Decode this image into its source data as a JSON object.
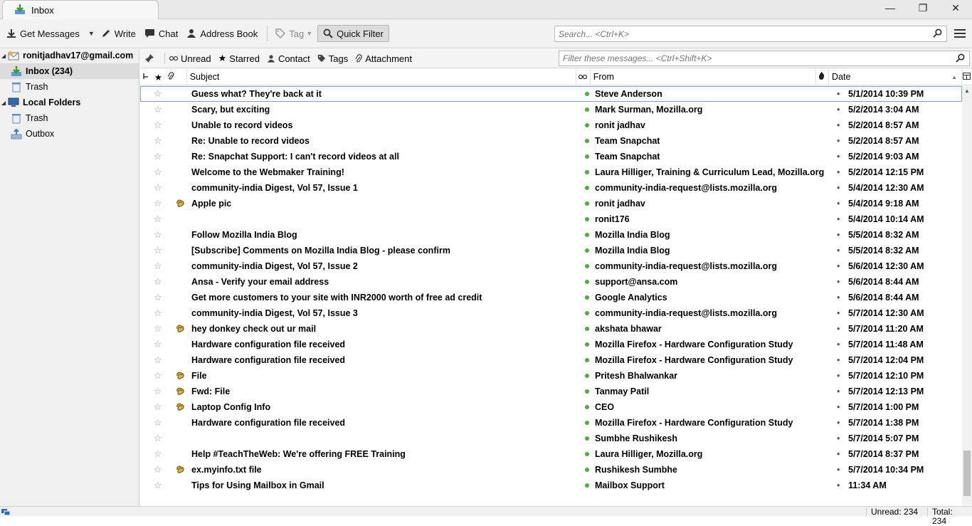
{
  "tab": {
    "title": "Inbox",
    "icon": "inbox-tab-icon"
  },
  "window_controls": {
    "minimize": "—",
    "restore": "❐",
    "close": "✕"
  },
  "toolbar": {
    "get_messages": "Get Messages",
    "write": "Write",
    "chat": "Chat",
    "address_book": "Address Book",
    "tag": "Tag",
    "quick_filter": "Quick Filter",
    "search_placeholder": "Search... <Ctrl+K>"
  },
  "folders": {
    "account": "ronitjadhav17@gmail.com",
    "inbox": "Inbox (234)",
    "trash1": "Trash",
    "local_folders": "Local Folders",
    "trash2": "Trash",
    "outbox": "Outbox"
  },
  "quickfilter": {
    "unread": "Unread",
    "starred": "Starred",
    "contact": "Contact",
    "tags": "Tags",
    "attachment": "Attachment",
    "filter_placeholder": "Filter these messages... <Ctrl+Shift+K>"
  },
  "columns": {
    "subject": "Subject",
    "from": "From",
    "date": "Date"
  },
  "messages": [
    {
      "subject": "Guess what? They're back at it",
      "from": "Steve Anderson",
      "date": "5/1/2014 10:39 PM",
      "attachment": false
    },
    {
      "subject": "Scary, but exciting",
      "from": "Mark Surman, Mozilla.org",
      "date": "5/2/2014 3:04 AM",
      "attachment": false
    },
    {
      "subject": "Unable to record videos",
      "from": "ronit jadhav",
      "date": "5/2/2014 8:57 AM",
      "attachment": false
    },
    {
      "subject": "Re: Unable to record videos",
      "from": "Team Snapchat",
      "date": "5/2/2014 8:57 AM",
      "attachment": false
    },
    {
      "subject": "Re: Snapchat Support: I can't record videos at all",
      "from": "Team Snapchat",
      "date": "5/2/2014 9:03 AM",
      "attachment": false
    },
    {
      "subject": "Welcome to the Webmaker Training!",
      "from": "Laura Hilliger, Training & Curriculum Lead, Mozilla.org",
      "date": "5/2/2014 12:15 PM",
      "attachment": false
    },
    {
      "subject": "community-india Digest, Vol 57, Issue 1",
      "from": "community-india-request@lists.mozilla.org",
      "date": "5/4/2014 12:30 AM",
      "attachment": false
    },
    {
      "subject": "Apple pic",
      "from": "ronit jadhav",
      "date": "5/4/2014 9:18 AM",
      "attachment": true
    },
    {
      "subject": "",
      "from": "ronit176",
      "date": "5/4/2014 10:14 AM",
      "attachment": false
    },
    {
      "subject": "Follow Mozilla India Blog",
      "from": "Mozilla India Blog",
      "date": "5/5/2014 8:32 AM",
      "attachment": false
    },
    {
      "subject": "[Subscribe] Comments on Mozilla India Blog - please confirm",
      "from": "Mozilla India Blog",
      "date": "5/5/2014 8:32 AM",
      "attachment": false
    },
    {
      "subject": "community-india Digest, Vol 57, Issue 2",
      "from": "community-india-request@lists.mozilla.org",
      "date": "5/6/2014 12:30 AM",
      "attachment": false
    },
    {
      "subject": "Ansa - Verify your email address",
      "from": "support@ansa.com",
      "date": "5/6/2014 8:44 AM",
      "attachment": false
    },
    {
      "subject": "Get more customers to your site with INR2000 worth of free ad credit",
      "from": "Google Analytics",
      "date": "5/6/2014 8:44 AM",
      "attachment": false
    },
    {
      "subject": "community-india Digest, Vol 57, Issue 3",
      "from": "community-india-request@lists.mozilla.org",
      "date": "5/7/2014 12:30 AM",
      "attachment": false
    },
    {
      "subject": "hey donkey check out ur mail",
      "from": "akshata bhawar",
      "date": "5/7/2014 11:20 AM",
      "attachment": true
    },
    {
      "subject": "Hardware configuration file received",
      "from": "Mozilla Firefox - Hardware Configuration Study",
      "date": "5/7/2014 11:48 AM",
      "attachment": false
    },
    {
      "subject": "Hardware configuration file received",
      "from": "Mozilla Firefox - Hardware Configuration Study",
      "date": "5/7/2014 12:04 PM",
      "attachment": false
    },
    {
      "subject": "File",
      "from": "Pritesh Bhalwankar",
      "date": "5/7/2014 12:10 PM",
      "attachment": true
    },
    {
      "subject": "Fwd: File",
      "from": "Tanmay Patil",
      "date": "5/7/2014 12:13 PM",
      "attachment": true
    },
    {
      "subject": "Laptop Config Info",
      "from": "CEO",
      "date": "5/7/2014 1:00 PM",
      "attachment": true
    },
    {
      "subject": "Hardware configuration file received",
      "from": "Mozilla Firefox - Hardware Configuration Study",
      "date": "5/7/2014 1:38 PM",
      "attachment": false
    },
    {
      "subject": "",
      "from": "Sumbhe Rushikesh",
      "date": "5/7/2014 5:07 PM",
      "attachment": false
    },
    {
      "subject": "Help #TeachTheWeb: We're offering FREE Training",
      "from": "Laura Hilliger, Mozilla.org",
      "date": "5/7/2014 8:37 PM",
      "attachment": false
    },
    {
      "subject": "ex.myinfo.txt file",
      "from": "Rushikesh Sumbhe",
      "date": "5/7/2014 10:34 PM",
      "attachment": true
    },
    {
      "subject": "Tips for Using Mailbox in Gmail",
      "from": "Mailbox Support",
      "date": "11:34 AM",
      "attachment": false
    }
  ],
  "status": {
    "unread": "Unread: 234",
    "total": "Total: 234"
  },
  "colors": {
    "unread_dot": "#4caf3a",
    "selected_folder": "#dcdcdc"
  }
}
